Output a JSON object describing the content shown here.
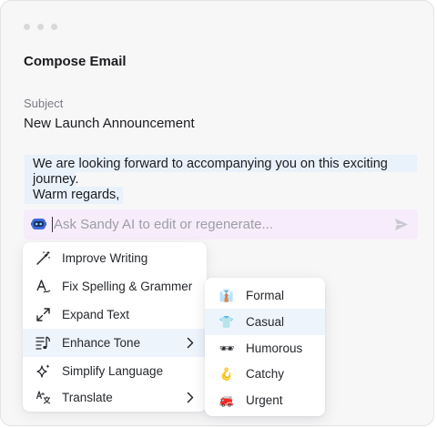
{
  "window": {
    "title": "Compose Email",
    "subject_label": "Subject",
    "subject_value": "New Launch Announcement"
  },
  "body": {
    "lines": [
      "We are looking forward to accompanying you on this exciting",
      "journey.",
      "Warm regards,"
    ]
  },
  "ai_bar": {
    "placeholder": "Ask Sandy AI to edit or regenerate...",
    "icon": "robot-icon",
    "send_icon": "send-icon",
    "accent": "#f7ecfb"
  },
  "menu": {
    "items": [
      {
        "label": "Improve Writing",
        "icon": "magic-wand-icon"
      },
      {
        "label": "Fix Spelling & Grammer",
        "icon": "spell-check-icon"
      },
      {
        "label": "Expand Text",
        "icon": "expand-icon"
      },
      {
        "label": "Enhance Tone",
        "icon": "tone-icon",
        "has_submenu": true,
        "active": true
      },
      {
        "label": "Simplify Language",
        "icon": "sparkle-icon"
      },
      {
        "label": "Translate",
        "icon": "translate-icon",
        "has_submenu": true
      }
    ]
  },
  "submenu": {
    "items": [
      {
        "label": "Formal",
        "icon": "necktie-icon",
        "glyph": "👔"
      },
      {
        "label": "Casual",
        "icon": "tshirt-icon",
        "glyph": "👕",
        "active": true
      },
      {
        "label": "Humorous",
        "icon": "sunglasses-icon",
        "glyph": "🕶"
      },
      {
        "label": "Catchy",
        "icon": "hook-icon",
        "glyph": "🪝"
      },
      {
        "label": "Urgent",
        "icon": "fire-engine-icon",
        "glyph": "🚒"
      }
    ]
  },
  "colors": {
    "highlight": "#e9f1fb",
    "active_item": "#eef4fc",
    "background": "#f7f7f8"
  }
}
